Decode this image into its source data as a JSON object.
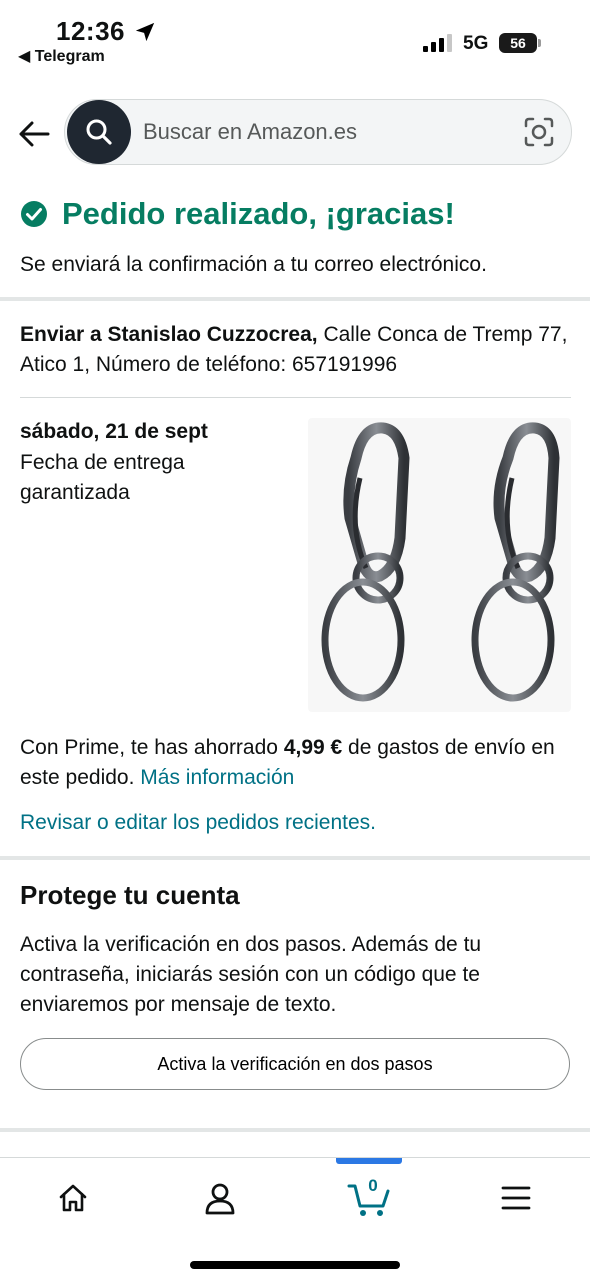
{
  "status_bar": {
    "time": "12:36",
    "back_app": "◀ Telegram",
    "network": "5G",
    "battery": "56"
  },
  "search": {
    "placeholder": "Buscar en Amazon.es"
  },
  "confirmation": {
    "title": "Pedido realizado, ¡gracias!",
    "subtitle": "Se enviará la confirmación a tu correo electrónico."
  },
  "shipping": {
    "label": "Enviar a Stanislao Cuzzocrea,",
    "address": " Calle Conca de Tremp 77, Atico 1, Número de teléfono: 657191996"
  },
  "delivery": {
    "date": "sábado, 21 de sept",
    "note": "Fecha de entrega garantizada"
  },
  "prime": {
    "text_before": "Con Prime, te has ahorrado ",
    "amount": "4,99 €",
    "text_after": " de gastos de envío en este pedido. ",
    "link": "Más información"
  },
  "review_link": "Revisar o editar los pedidos recientes.",
  "protect": {
    "title": "Protege tu cuenta",
    "text": "Activa la verificación en dos pasos. Además de tu contraseña, iniciarás sesión con un código que te enviaremos por mensaje de texto.",
    "button": "Activa la verificación en dos pasos"
  },
  "bottom_nav": {
    "cart_count": "0",
    "items": [
      "home-icon",
      "account-icon",
      "cart-icon",
      "menu-icon"
    ]
  },
  "colors": {
    "success": "#067d62",
    "link": "#007185",
    "active_tab": "#2b78e4"
  }
}
